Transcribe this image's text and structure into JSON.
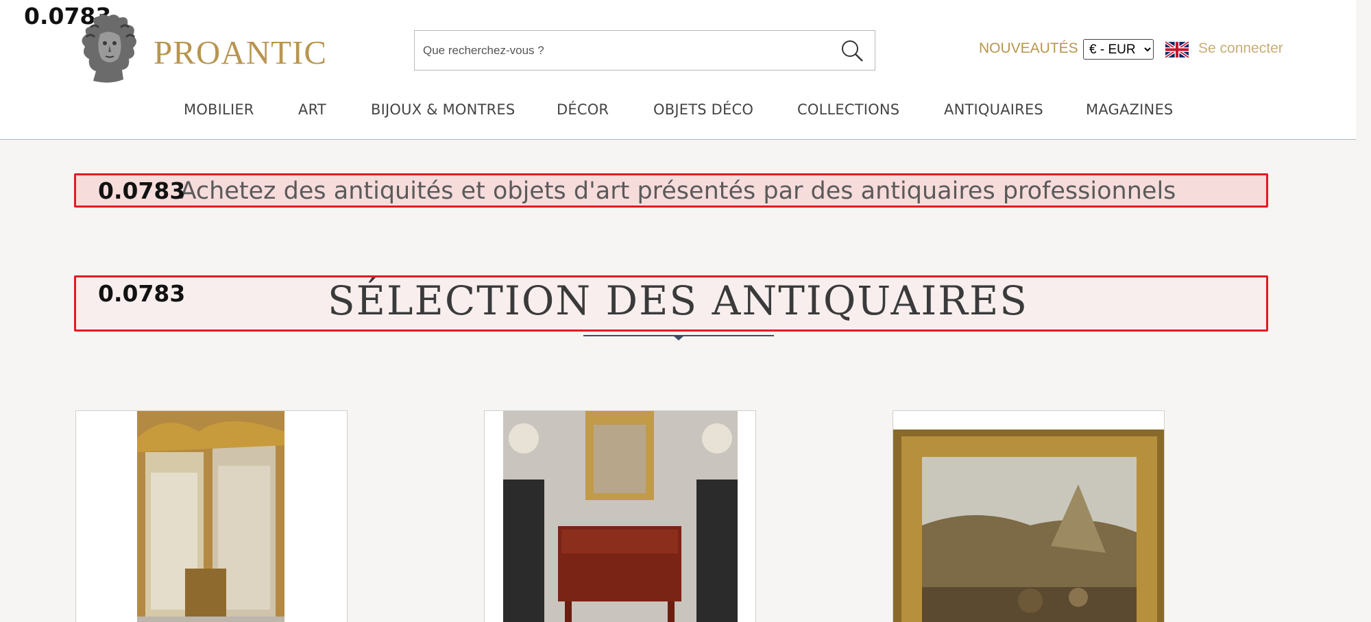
{
  "overlay_scores": {
    "top_left": "0.0783",
    "banner": "0.0783",
    "section": "0.0783"
  },
  "brand": {
    "name": "PROANTIC",
    "accent_color": "#b89550"
  },
  "search": {
    "placeholder": "Que recherchez-vous ?",
    "value": ""
  },
  "header": {
    "nouveautes_label": "NOUVEAUTÉS",
    "currency_selected": "€ - EUR",
    "language_flag": "uk-flag-icon",
    "login_label": "Se connecter"
  },
  "nav": {
    "items": [
      {
        "label": "MOBILIER"
      },
      {
        "label": "ART"
      },
      {
        "label": "BIJOUX & MONTRES"
      },
      {
        "label": "DÉCOR"
      },
      {
        "label": "OBJETS DÉCO"
      },
      {
        "label": "COLLECTIONS"
      },
      {
        "label": "ANTIQUAIRES"
      },
      {
        "label": "MAGAZINES"
      }
    ]
  },
  "banner": {
    "text": "Achetez des antiquités et objets d'art présentés par des antiquaires professionnels"
  },
  "section": {
    "title": "SÉLECTION DES ANTIQUAIRES"
  },
  "products": [
    {
      "image": "gilded-mirrors-photo"
    },
    {
      "image": "mahogany-console-photo"
    },
    {
      "image": "framed-landscape-painting-photo"
    }
  ],
  "colors": {
    "highlight_border": "#e11b22",
    "highlight_fill": "#f7dcdc",
    "nav_text": "#444444",
    "page_bg": "#f6f5f3"
  }
}
